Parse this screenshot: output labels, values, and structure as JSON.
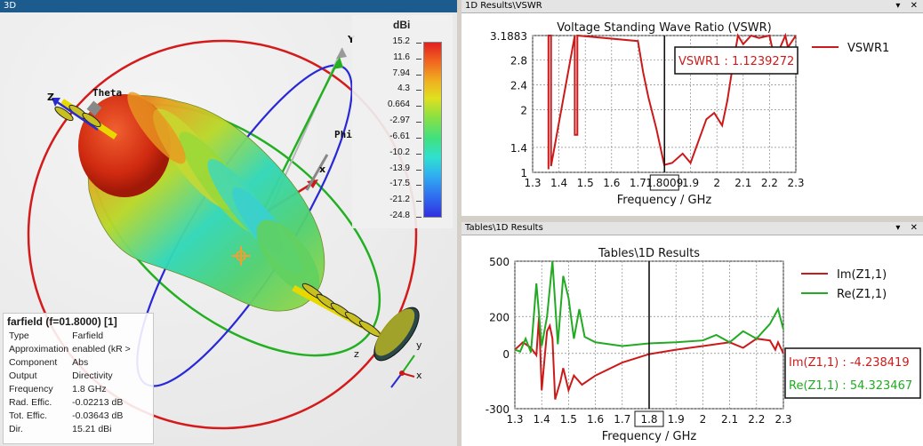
{
  "view3d": {
    "title": "3D",
    "axis_labels": {
      "x": "x",
      "y": "Y",
      "z": "Z",
      "theta": "Theta",
      "phi": "Phi"
    },
    "triad": {
      "x": "x",
      "y": "y",
      "z": "z"
    }
  },
  "colorbar": {
    "unit": "dBi",
    "ticks": [
      "15.2",
      "11.6",
      "7.94",
      "4.3",
      "0.664",
      "-2.97",
      "-6.61",
      "-10.2",
      "-13.9",
      "-17.5",
      "-21.2",
      "-24.8"
    ]
  },
  "info": {
    "header": "farfield (f=01.8000) [1]",
    "rows": [
      {
        "label": "Type",
        "value": "Farfield"
      },
      {
        "label": "Approximation",
        "value": "enabled (kR >"
      },
      {
        "label": "Component",
        "value": "Abs"
      },
      {
        "label": "Output",
        "value": "Directivity"
      },
      {
        "label": "Frequency",
        "value": "1.8 GHz"
      },
      {
        "label": "Rad. Effic.",
        "value": "-0.02213 dB"
      },
      {
        "label": "Tot. Effic.",
        "value": "-0.03643 dB"
      },
      {
        "label": "Dir.",
        "value": "15.21 dBi"
      }
    ]
  },
  "vswr_panel": {
    "title": "1D Results\\VSWR",
    "window_buttons": "▾ ✕",
    "chart_title": "Voltage Standing Wave Ratio (VSWR)",
    "xlabel": "Frequency / GHz",
    "marker_label": "1.8009",
    "marker_value": "VSWR1 : 1.1239272",
    "legend": [
      "VSWR1"
    ],
    "xticks": [
      "1.3",
      "1.4",
      "1.5",
      "1.6",
      "1.7",
      "1.8",
      "1.9",
      "2",
      "2.1",
      "2.2",
      "2.3"
    ],
    "yticks": [
      "3.1883",
      "2.8",
      "2.4",
      "2",
      "1.4",
      "1"
    ]
  },
  "z_panel": {
    "title": "Tables\\1D Results",
    "window_buttons": "▾ ✕",
    "chart_title": "Tables\\1D Results",
    "xlabel": "Frequency / GHz",
    "marker_label": "1.8",
    "marker_values": [
      "Im(Z1,1) : -4.238419",
      "Re(Z1,1) : 54.323467"
    ],
    "legend": [
      "Im(Z1,1)",
      "Re(Z1,1)"
    ],
    "xticks": [
      "1.3",
      "1.4",
      "1.5",
      "1.6",
      "1.7",
      "1.8",
      "1.9",
      "2",
      "2.1",
      "2.2",
      "2.3"
    ],
    "yticks": [
      "500",
      "200",
      "0",
      "-300"
    ]
  },
  "colors": {
    "red": "#cc1a1a",
    "green": "#22aa22",
    "blue": "#2a2ad0",
    "titlebar": "#1c5b8e"
  },
  "chart_data": [
    {
      "type": "line",
      "title": "Voltage Standing Wave Ratio (VSWR)",
      "xlabel": "Frequency / GHz",
      "ylabel": "",
      "xlim": [
        1.3,
        2.3
      ],
      "ylim": [
        1,
        3.1883
      ],
      "series": [
        {
          "name": "VSWR1",
          "x": [
            1.36,
            1.36,
            1.37,
            1.37,
            1.46,
            1.46,
            1.47,
            1.47,
            1.7,
            1.72,
            1.74,
            1.77,
            1.8,
            1.83,
            1.87,
            1.9,
            1.93,
            1.96,
            1.99,
            2.02,
            2.04,
            2.06,
            2.08,
            2.1,
            2.13,
            2.16,
            2.2,
            2.22,
            2.26,
            2.27,
            2.3
          ],
          "y": [
            1.05,
            3.19,
            3.19,
            1.1,
            3.19,
            1.6,
            1.6,
            3.19,
            3.1,
            2.6,
            2.2,
            1.7,
            1.12,
            1.15,
            1.3,
            1.15,
            1.5,
            1.85,
            1.95,
            1.75,
            2.15,
            2.7,
            3.19,
            3.05,
            3.19,
            3.15,
            3.19,
            2.8,
            3.19,
            3.0,
            3.19
          ]
        }
      ],
      "marker_x": 1.8009,
      "marker_y": 1.1239272
    },
    {
      "type": "line",
      "title": "Tables\\1D Results",
      "xlabel": "Frequency / GHz",
      "ylabel": "",
      "xlim": [
        1.3,
        2.3
      ],
      "ylim": [
        -300,
        500
      ],
      "series": [
        {
          "name": "Im(Z1,1)",
          "x": [
            1.3,
            1.33,
            1.36,
            1.38,
            1.39,
            1.4,
            1.42,
            1.43,
            1.44,
            1.45,
            1.47,
            1.48,
            1.5,
            1.52,
            1.55,
            1.6,
            1.7,
            1.8,
            1.9,
            2.0,
            2.05,
            2.1,
            2.15,
            2.2,
            2.25,
            2.27,
            2.28,
            2.3
          ],
          "y": [
            20,
            60,
            30,
            -10,
            200,
            -200,
            120,
            150,
            80,
            -250,
            -150,
            -80,
            -200,
            -120,
            -170,
            -120,
            -50,
            -4.24,
            20,
            40,
            50,
            60,
            30,
            80,
            70,
            20,
            60,
            0
          ]
        },
        {
          "name": "Re(Z1,1)",
          "x": [
            1.3,
            1.32,
            1.34,
            1.36,
            1.38,
            1.4,
            1.42,
            1.44,
            1.46,
            1.48,
            1.5,
            1.52,
            1.54,
            1.56,
            1.6,
            1.7,
            1.8,
            1.9,
            2.0,
            2.05,
            2.1,
            2.15,
            2.2,
            2.25,
            2.28,
            2.3
          ],
          "y": [
            20,
            10,
            80,
            5,
            380,
            40,
            200,
            500,
            50,
            420,
            300,
            80,
            240,
            90,
            60,
            40,
            54.3,
            60,
            70,
            100,
            60,
            120,
            80,
            160,
            240,
            130
          ]
        }
      ],
      "marker_x": 1.8
    }
  ]
}
